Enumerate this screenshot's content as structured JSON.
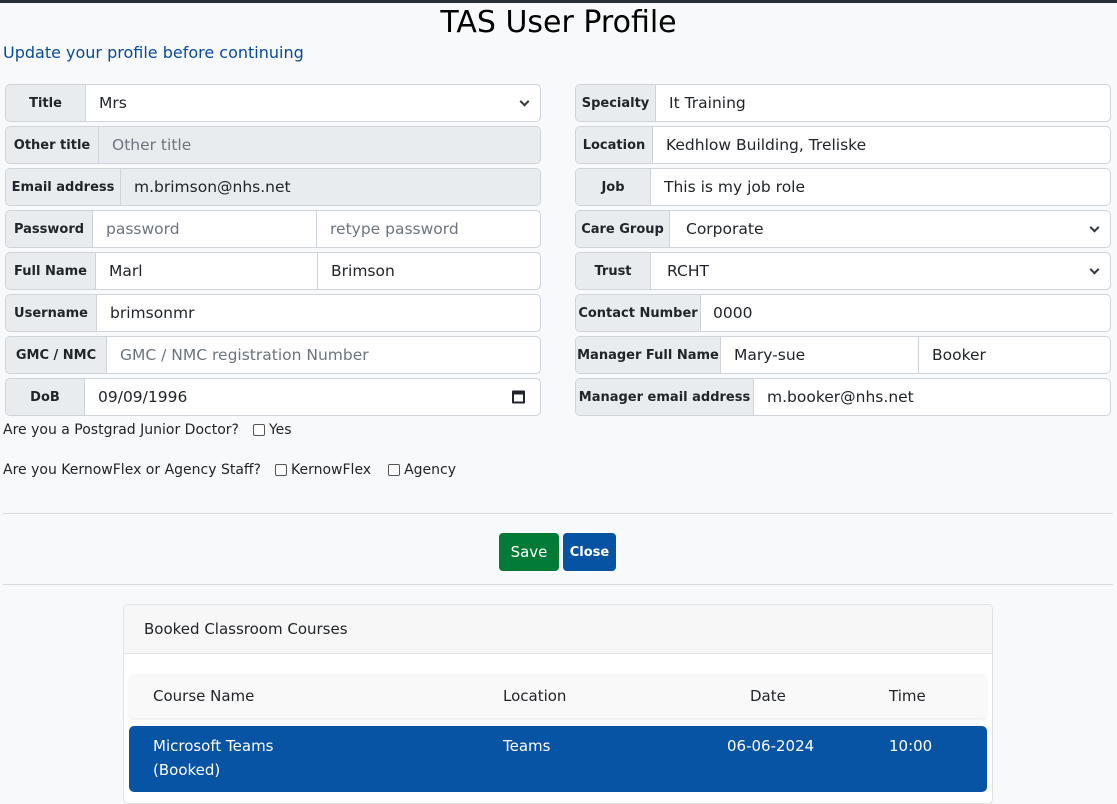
{
  "header": {
    "title": "TAS User Profile",
    "subtitle": "Update your profile before continuing"
  },
  "form_left": {
    "title": {
      "label": "Title",
      "value": "Mrs"
    },
    "other_title": {
      "label": "Other title",
      "placeholder": "Other title"
    },
    "email": {
      "label": "Email address",
      "value": "m.brimson@nhs.net"
    },
    "password": {
      "label": "Password",
      "placeholder": "password",
      "retype_placeholder": "retype password"
    },
    "full_name": {
      "label": "Full Name",
      "first": "Marl",
      "last": "Brimson"
    },
    "username": {
      "label": "Username",
      "value": "brimsonmr"
    },
    "gmc": {
      "label": "GMC / NMC",
      "placeholder": "GMC / NMC registration Number"
    },
    "dob": {
      "label": "DoB",
      "value": "09/09/1996"
    }
  },
  "form_right": {
    "specialty": {
      "label": "Specialty",
      "value": "It Training"
    },
    "location": {
      "label": "Location",
      "value": "Kedhlow Building, Treliske"
    },
    "job": {
      "label": "Job",
      "value": "This is my job role"
    },
    "care_group": {
      "label": "Care Group",
      "value": "Corporate"
    },
    "trust": {
      "label": "Trust",
      "value": "RCHT"
    },
    "contact": {
      "label": "Contact Number",
      "value": "0000"
    },
    "manager_name": {
      "label": "Manager Full Name",
      "first": "Mary-sue",
      "last": "Booker"
    },
    "manager_email": {
      "label": "Manager email address",
      "value": "m.booker@nhs.net"
    }
  },
  "questions": {
    "junior_doctor": {
      "text": "Are you a Postgrad Junior Doctor?",
      "options": [
        {
          "label": "Yes",
          "checked": false
        }
      ]
    },
    "staff_type": {
      "text": "Are you KernowFlex or Agency Staff?",
      "options": [
        {
          "label": "KernowFlex",
          "checked": false
        },
        {
          "label": "Agency",
          "checked": false
        }
      ]
    }
  },
  "actions": {
    "save": "Save",
    "close": "Close"
  },
  "colors": {
    "save": "#027b36",
    "close": "#0652a3",
    "booked_row": "#0753a4",
    "subtitle": "#0a4a9e"
  },
  "courses": {
    "title": "Booked Classroom Courses",
    "columns": [
      "Course Name",
      "Location",
      "Date",
      "Time"
    ],
    "rows": [
      {
        "name": "Microsoft Teams",
        "status": "(Booked)",
        "location": "Teams",
        "date": "06-06-2024",
        "time": "10:00"
      }
    ]
  }
}
